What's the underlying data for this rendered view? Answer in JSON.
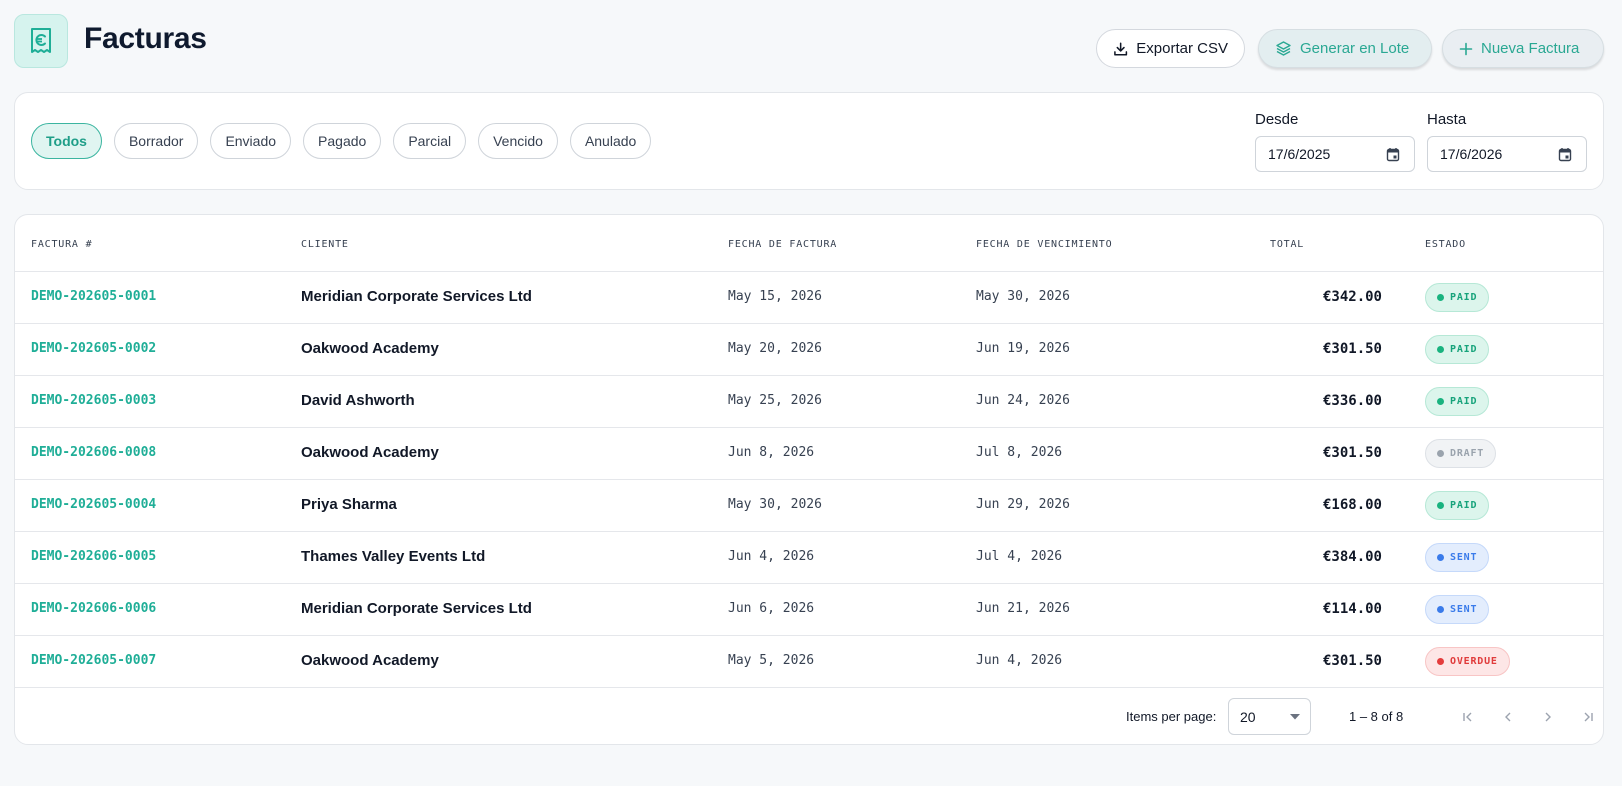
{
  "header": {
    "title": "Facturas",
    "logo_icon": "euro-receipt-icon",
    "buttons": {
      "export_label": "Exportar CSV",
      "batch_label": "Generar en Lote",
      "new_label": "Nueva Factura"
    }
  },
  "filters": {
    "status_chips": [
      {
        "label": "Todos",
        "active": true
      },
      {
        "label": "Borrador",
        "active": false
      },
      {
        "label": "Enviado",
        "active": false
      },
      {
        "label": "Pagado",
        "active": false
      },
      {
        "label": "Parcial",
        "active": false
      },
      {
        "label": "Vencido",
        "active": false
      },
      {
        "label": "Anulado",
        "active": false
      }
    ],
    "from": {
      "label": "Desde",
      "value": "17/6/2025"
    },
    "to": {
      "label": "Hasta",
      "value": "17/6/2026"
    }
  },
  "table": {
    "columns": [
      "Factura #",
      "Cliente",
      "Fecha de Factura",
      "Fecha de Vencimiento",
      "Total",
      "Estado"
    ],
    "rows": [
      {
        "number": "DEMO-202605-0001",
        "client": "Meridian Corporate Services Ltd",
        "date": "May 15, 2026",
        "due": "May 30, 2026",
        "total": "€342.00",
        "status": "PAID"
      },
      {
        "number": "DEMO-202605-0002",
        "client": "Oakwood Academy",
        "date": "May 20, 2026",
        "due": "Jun 19, 2026",
        "total": "€301.50",
        "status": "PAID"
      },
      {
        "number": "DEMO-202605-0003",
        "client": "David Ashworth",
        "date": "May 25, 2026",
        "due": "Jun 24, 2026",
        "total": "€336.00",
        "status": "PAID"
      },
      {
        "number": "DEMO-202606-0008",
        "client": "Oakwood Academy",
        "date": "Jun 8, 2026",
        "due": "Jul 8, 2026",
        "total": "€301.50",
        "status": "DRAFT"
      },
      {
        "number": "DEMO-202605-0004",
        "client": "Priya Sharma",
        "date": "May 30, 2026",
        "due": "Jun 29, 2026",
        "total": "€168.00",
        "status": "PAID"
      },
      {
        "number": "DEMO-202606-0005",
        "client": "Thames Valley Events Ltd",
        "date": "Jun 4, 2026",
        "due": "Jul 4, 2026",
        "total": "€384.00",
        "status": "SENT"
      },
      {
        "number": "DEMO-202606-0006",
        "client": "Meridian Corporate Services Ltd",
        "date": "Jun 6, 2026",
        "due": "Jun 21, 2026",
        "total": "€114.00",
        "status": "SENT"
      },
      {
        "number": "DEMO-202605-0007",
        "client": "Oakwood Academy",
        "date": "May 5, 2026",
        "due": "Jun 4, 2026",
        "total": "€301.50",
        "status": "OVERDUE"
      }
    ]
  },
  "pagination": {
    "items_per_page_label": "Items per page:",
    "items_per_page": "20",
    "range": "1 – 8 of 8"
  },
  "colors": {
    "accent": "#1fae97",
    "paid": "#17a37b",
    "sent": "#3a7bea",
    "overdue": "#e03b3b",
    "draft": "#9aa3ad"
  }
}
